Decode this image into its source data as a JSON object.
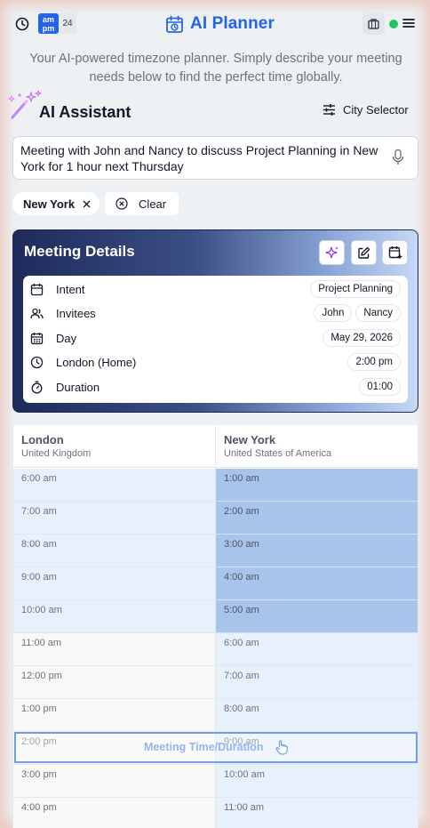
{
  "header": {
    "ampm_top": "am",
    "ampm_bottom": "pm",
    "h24_label": "24",
    "title": "AI Planner",
    "status_color": "#22c55e",
    "brand_color": "#2563eb"
  },
  "tagline": "Your AI-powered timezone planner. Simply describe your meeting needs below to find the perfect time globally.",
  "assistant": {
    "title": "AI Assistant",
    "city_selector_label": "City Selector",
    "prompt": "Meeting with John and Nancy to discuss Project Planning in New York for 1 hour next Thursday"
  },
  "chips": {
    "city": "New York",
    "clear_label": "Clear"
  },
  "meeting_details": {
    "title": "Meeting Details",
    "rows": [
      {
        "label": "Intent",
        "values": [
          "Project Planning"
        ],
        "icon": "calendar-icon"
      },
      {
        "label": "Invitees",
        "values": [
          "John",
          "Nancy"
        ],
        "icon": "users-icon"
      },
      {
        "label": "Day",
        "values": [
          "May 29, 2026"
        ],
        "icon": "calendar-grid-icon"
      },
      {
        "label": "London (Home)",
        "values": [
          "2:00 pm"
        ],
        "icon": "clock-icon"
      },
      {
        "label": "Duration",
        "values": [
          "01:00"
        ],
        "icon": "stopwatch-icon"
      }
    ]
  },
  "timezones": {
    "columns": [
      {
        "city": "London",
        "country": "United Kingdom"
      },
      {
        "city": "New York",
        "country": "United States of America"
      }
    ],
    "london_times": [
      "6:00 am",
      "7:00 am",
      "8:00 am",
      "9:00 am",
      "10:00 am",
      "11:00 am",
      "12:00 pm",
      "1:00 pm",
      "2:00 pm",
      "3:00 pm",
      "4:00 pm"
    ],
    "newyork_times": [
      "1:00 am",
      "2:00 am",
      "3:00 am",
      "4:00 am",
      "5:00 am",
      "6:00 am",
      "7:00 am",
      "8:00 am",
      "9:00 am",
      "10:00 am",
      "11:00 am"
    ],
    "meeting_label": "Meeting Time/Duration"
  }
}
